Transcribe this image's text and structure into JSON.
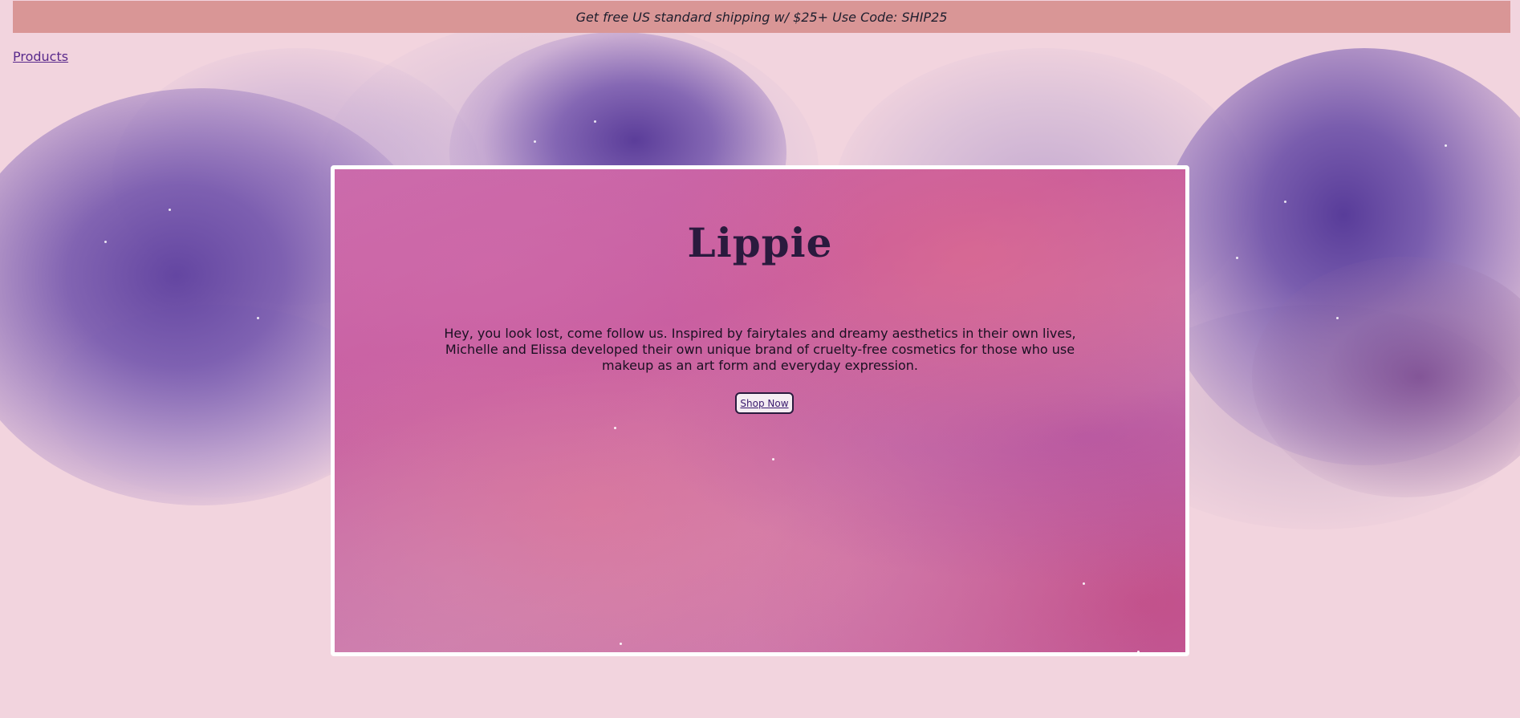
{
  "announcement": {
    "text": "Get free US standard shipping w/ $25+ Use Code: SHIP25"
  },
  "nav": {
    "products_label": "Products"
  },
  "hero": {
    "title": "Lippie",
    "description": "Hey, you look lost, come follow us. Inspired by fairytales and dreamy aesthetics in their own lives, Michelle and Elissa developed their own unique brand of cruelty-free cosmetics for those who use makeup as an art form and everyday expression.",
    "cta_label": "Shop Now"
  },
  "colors": {
    "page_background": "#f2d4de",
    "announcement_background": "#d99696",
    "link": "#5a2a8c",
    "title": "#2a1a3e"
  }
}
